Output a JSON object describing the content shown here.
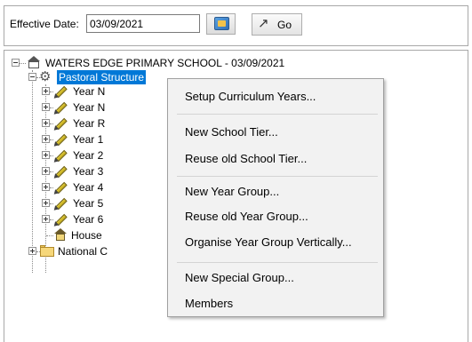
{
  "toolbar": {
    "effective_date_label": "Effective Date:",
    "effective_date_value": "03/09/2021",
    "go_label": "Go",
    "calendar_icon": "calendar-icon",
    "go_icon": "go-arrow-icon"
  },
  "tree": {
    "root_label": "WATERS EDGE PRIMARY SCHOOL - 03/09/2021",
    "pastoral_label": "Pastoral Structure",
    "year_items": [
      "Year N",
      "Year N",
      "Year R",
      "Year 1",
      "Year 2",
      "Year 3",
      "Year 4",
      "Year 5",
      "Year 6"
    ],
    "house_label": "House",
    "national_label": "National C"
  },
  "context_menu": {
    "items": [
      "Setup Curriculum Years...",
      "New School Tier...",
      "Reuse old School Tier...",
      "New Year Group...",
      "Reuse old Year Group...",
      "Organise Year Group Vertically...",
      "New Special Group...",
      "Members"
    ]
  },
  "colors": {
    "selection": "#0078d7",
    "menu_background": "#f2f2f2"
  }
}
